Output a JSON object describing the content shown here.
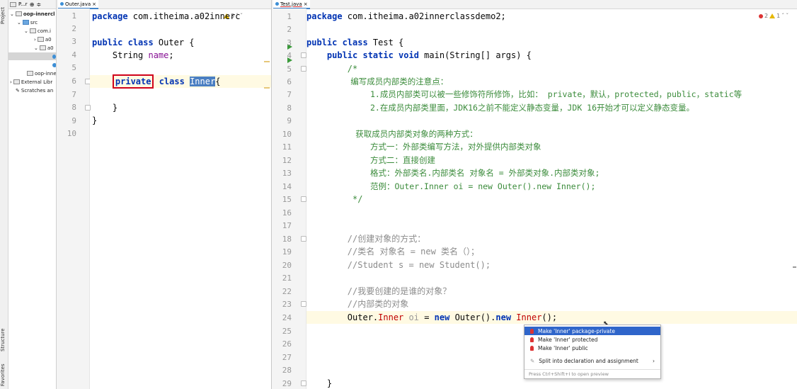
{
  "toolstrip": {
    "project": "Project",
    "structure": "Structure",
    "favorites": "Favorites"
  },
  "project_panel": {
    "header": "P...r",
    "items": [
      "oop-innercl",
      "src",
      "com.i",
      "a0",
      "a0",
      "",
      "",
      "oop-inne",
      "External Libr",
      "Scratches an"
    ]
  },
  "left_editor": {
    "tab": "Outer.java",
    "warnings": "3",
    "lines": [
      {
        "n": "1"
      },
      {
        "n": "2"
      },
      {
        "n": "3"
      },
      {
        "n": "4"
      },
      {
        "n": "5"
      },
      {
        "n": "6"
      },
      {
        "n": "7"
      },
      {
        "n": "8"
      },
      {
        "n": "9"
      },
      {
        "n": "10"
      }
    ],
    "code": {
      "l1_kw": "package",
      "l1_rest": " com.itheima.a02innerc",
      "l3_kw": "public class",
      "l3_rest": " Outer {",
      "l4_type": "    String ",
      "l4_field": "name",
      "l4_end": ";",
      "l6_indent": "    ",
      "l6_private": "private",
      "l6_kw": " class ",
      "l6_inner": "Inner",
      "l6_brace": "{",
      "l8": "    }",
      "l9": "}"
    }
  },
  "right_editor": {
    "tab": "Test.java",
    "errors": "2",
    "warnings": "1",
    "lines": [
      "1",
      "2",
      "3",
      "4",
      "5",
      "6",
      "7",
      "8",
      "9",
      "10",
      "11",
      "12",
      "13",
      "14",
      "15",
      "16",
      "17",
      "18",
      "19",
      "20",
      "21",
      "22",
      "23",
      "24",
      "25",
      "26",
      "27",
      "28",
      "29"
    ],
    "code": {
      "l1_kw": "package",
      "l1_rest": " com.itheima.a02innerclassdemo2;",
      "l3_kw": "public class",
      "l3_rest": " Test {",
      "l4_kw": "    public static void",
      "l4_rest": " main(String[] args) {",
      "l5": "        /*",
      "l6": "         编写成员内部类的注意点：",
      "l7": "             1.成员内部类可以被一些修饰符所修饰，比如： private，默认，protected，public，static等",
      "l8": "             2.在成员内部类里面，JDK16之前不能定义静态变量，JDK 16开始才可以定义静态变量。",
      "l10": "          获取成员内部类对象的两种方式：",
      "l11": "             方式一：外部类编写方法，对外提供内部类对象",
      "l12": "             方式二：直接创建",
      "l13": "             格式：外部类名.内部类名 对象名 = 外部类对象.内部类对象;",
      "l14": "             范例：Outer.Inner oi = new Outer().new Inner();",
      "l15": "         */",
      "l18": "        //创建对象的方式：",
      "l19": "        //类名 对象名 = new 类名（）；",
      "l20": "        //Student s = new Student();",
      "l22": "        //我要创建的是谁的对象？",
      "l23": "        //内部类的对象",
      "l24_a": "        Outer.",
      "l24_inner": "Inner",
      "l24_b": " ",
      "l24_oi": "oi",
      "l24_c": " = ",
      "l24_new": "new",
      "l24_d": " Outer().",
      "l24_new2": "new",
      "l24_e": " ",
      "l24_inner2": "Inner",
      "l24_f": "();",
      "l29": "    }"
    }
  },
  "popup": {
    "items": [
      "Make 'Inner' package-private",
      "Make 'Inner' protected",
      "Make 'Inner' public",
      "Split into declaration and assignment"
    ],
    "footer": "Press Ctrl+Shift+I to open preview"
  },
  "colors": {
    "keyword": "#0033b3",
    "comment": "#8c8c8c",
    "error": "#c00000",
    "highlight_box": "#d0021b",
    "popup_active": "#2f65ca"
  }
}
